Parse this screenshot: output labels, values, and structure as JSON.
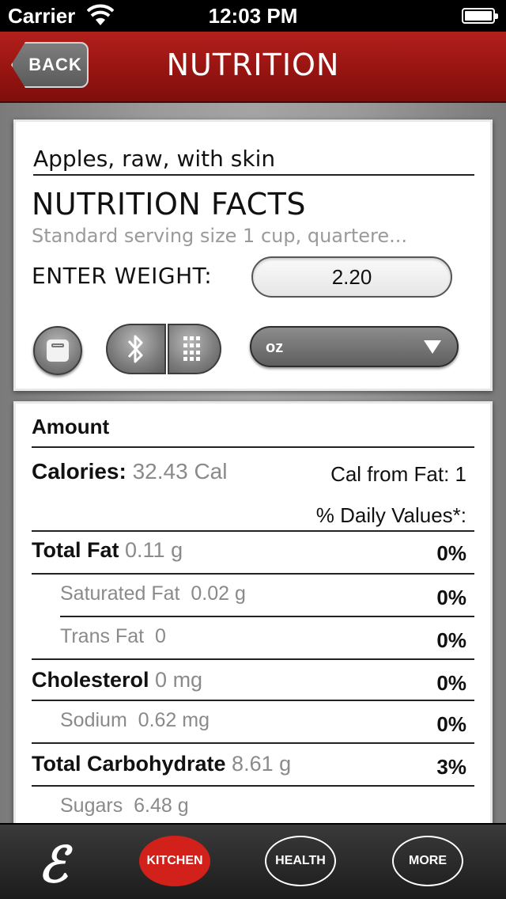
{
  "status_bar": {
    "carrier": "Carrier",
    "time": "12:03 PM"
  },
  "nav": {
    "back_label": "BACK",
    "title": "NUTRITION"
  },
  "food": {
    "name": "Apples, raw, with skin",
    "facts_title": "NUTRITION FACTS",
    "serving": "Standard serving size 1 cup, quartere...",
    "weight_label": "ENTER WEIGHT:",
    "weight_value": "2.20",
    "unit_selected": "oz"
  },
  "icons": {
    "scale": "scale-icon",
    "bluetooth": "bluetooth-icon",
    "keypad": "keypad-icon",
    "dropdown": "chevron-down-icon"
  },
  "facts": {
    "amount_header": "Amount",
    "calories_label": "Calories:",
    "calories_value": "32.43 Cal",
    "cal_from_fat": "Cal from Fat: 1",
    "daily_values_header": "% Daily Values*:",
    "rows": [
      {
        "label": "Total Fat",
        "value": "0.11 g",
        "pct": "0%",
        "bold": true
      },
      {
        "label": "Saturated Fat",
        "value": "0.02 g",
        "pct": "0%",
        "bold": false
      },
      {
        "label": "Trans Fat",
        "value": "0",
        "pct": "0%",
        "bold": false
      },
      {
        "label": "Cholesterol",
        "value": "0 mg",
        "pct": "0%",
        "bold": true
      },
      {
        "label": "Sodium",
        "value": "0.62 mg",
        "pct": "0%",
        "bold": false
      },
      {
        "label": "Total Carbohydrate",
        "value": "8.61 g",
        "pct": "3%",
        "bold": true
      },
      {
        "label": "Sugars",
        "value": "6.48 g",
        "pct": "",
        "bold": false
      }
    ]
  },
  "tab_bar": {
    "logo": "ℰ",
    "kitchen": "KITCHEN",
    "health": "HEALTH",
    "more": "MORE"
  },
  "colors": {
    "nav_red": "#9a1512",
    "active_tab": "#d2201b",
    "muted_text": "#8a8a8a"
  }
}
